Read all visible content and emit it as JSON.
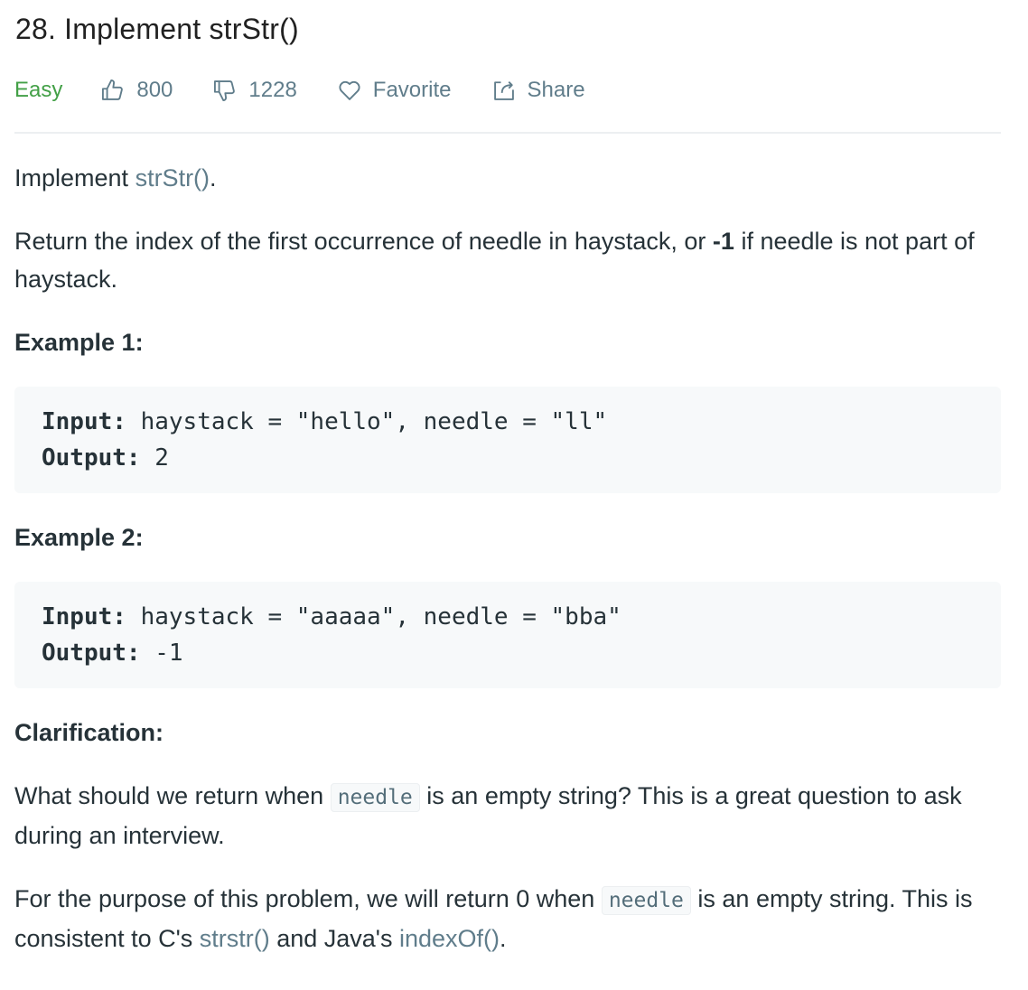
{
  "problem": {
    "title": "28. Implement strStr()",
    "difficulty": "Easy",
    "likes": "800",
    "dislikes": "1228",
    "favorite_label": "Favorite",
    "share_label": "Share"
  },
  "description": {
    "intro_prefix": "Implement ",
    "intro_link": "strStr()",
    "intro_suffix": ".",
    "return_prefix": "Return the index of the first occurrence of needle in haystack, or ",
    "return_bold": "-1",
    "return_suffix": " if needle is not part of haystack."
  },
  "examples": [
    {
      "heading": "Example 1:",
      "input_label": "Input:",
      "input_value": " haystack = \"hello\", needle = \"ll\"",
      "output_label": "Output:",
      "output_value": " 2"
    },
    {
      "heading": "Example 2:",
      "input_label": "Input:",
      "input_value": " haystack = \"aaaaa\", needle = \"bba\"",
      "output_label": "Output:",
      "output_value": " -1"
    }
  ],
  "clarification": {
    "heading": "Clarification:",
    "p1_prefix": "What should we return when ",
    "p1_code": "needle",
    "p1_suffix": " is an empty string? This is a great question to ask during an interview.",
    "p2_prefix": "For the purpose of this problem, we will return 0 when ",
    "p2_code": "needle",
    "p2_mid": " is an empty string. This is consistent to C's ",
    "p2_link1": "strstr()",
    "p2_and": " and Java's ",
    "p2_link2": "indexOf()",
    "p2_end": "."
  },
  "icons": {
    "like": "thumbs-up-icon",
    "dislike": "thumbs-down-icon",
    "favorite": "heart-icon",
    "share": "share-icon"
  },
  "colors": {
    "easy": "#43a047",
    "meta": "#607d8b",
    "link": "#607d8b",
    "code_bg": "#f7f9fa"
  }
}
